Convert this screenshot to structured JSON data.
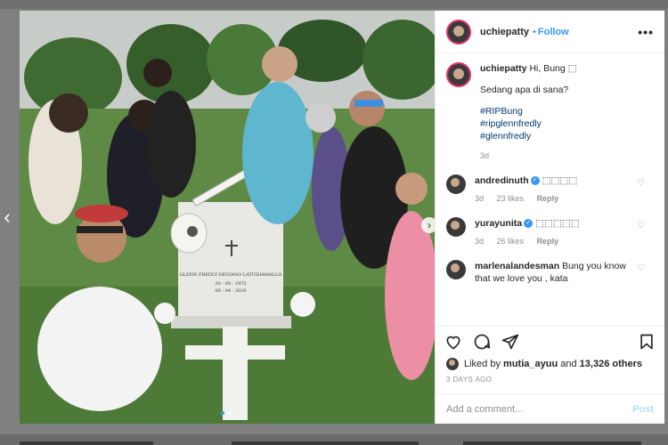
{
  "header": {
    "username": "uchiepatty",
    "separator": "•",
    "follow_label": "Follow",
    "more_label": "•••"
  },
  "caption": {
    "username": "uchiepatty",
    "text": "Hi, Bung ⬚",
    "line2": "Sedang apa di sana?",
    "hashtags": [
      "#RIPBung",
      "#ripglennfredly",
      "#glennfredly"
    ],
    "time": "3d"
  },
  "comments": [
    {
      "username": "andredinuth",
      "verified": true,
      "text": "⬚⬚⬚⬚",
      "time": "3d",
      "likes": "23 likes",
      "reply": "Reply"
    },
    {
      "username": "yurayunita",
      "verified": true,
      "text": "⬚⬚⬚⬚⬚",
      "time": "3d",
      "likes": "26 likes",
      "reply": "Reply"
    },
    {
      "username": "marlenalandesman",
      "verified": false,
      "text": "Bung you know that we love you , kata",
      "time": "",
      "likes": "",
      "reply": ""
    }
  ],
  "likes": {
    "prefix": "Liked by",
    "user": "mutia_ayuu",
    "joiner": "and",
    "others": "13,326 others"
  },
  "date": "3 DAYS AGO",
  "add_comment": {
    "placeholder": "Add a comment...",
    "post_label": "Post"
  },
  "photo": {
    "gravestone_text": "GLENN FREDLY DEVIANO LATUIHAMALLO",
    "birth": "30 - 09 - 1975",
    "death": "08 - 04 - 2020"
  },
  "nav": {
    "prev": "‹",
    "next": "›"
  },
  "icons": {
    "like": "heart-icon",
    "comment": "comment-icon",
    "share": "paper-plane-icon",
    "save": "bookmark-icon"
  },
  "colors": {
    "accent": "#3897f0",
    "story_ring": "#e1306c"
  }
}
